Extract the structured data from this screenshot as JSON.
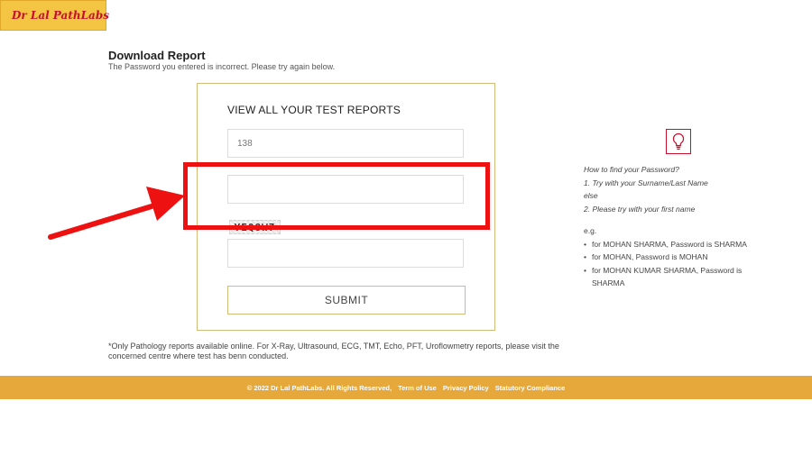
{
  "brand": {
    "logo_text": "Dr Lal PathLabs",
    "colors": {
      "brand_red": "#c8102e",
      "footer_orange": "#e6a83a",
      "box_border": "#d7b97a",
      "highlight_red": "#ee1111"
    }
  },
  "page": {
    "heading": "Download Report",
    "error_message": "The Password you entered is incorrect. Please try again below."
  },
  "form": {
    "title": "VIEW ALL YOUR TEST REPORTS",
    "lab_number_value": "138",
    "password_value": "",
    "captcha_text": "YEQ8W7",
    "captcha_value": "",
    "submit_label": "SUBMIT"
  },
  "hint": {
    "icon": "lightbulb-icon",
    "title": "How to find your Password?",
    "step1": "1. Try with your Surname/Last Name",
    "else_text": "else",
    "step2": "2. Please try with your first name",
    "example_label": "e.g.",
    "examples": [
      "for MOHAN SHARMA, Password is SHARMA",
      "for MOHAN, Password is MOHAN",
      "for MOHAN KUMAR SHARMA, Password is SHARMA"
    ]
  },
  "disclaimer": "*Only Pathology reports available online. For X-Ray, Ultrasound, ECG, TMT, Echo, PFT, Uroflowmetry reports, please visit the concerned centre where test has benn conducted.",
  "footer": {
    "copyright": "© 2022 Dr Lal PathLabs. All Rights Reserved,",
    "terms": "Term of Use",
    "privacy": "Privacy Policy",
    "compliance": "Statutory Compliance"
  }
}
